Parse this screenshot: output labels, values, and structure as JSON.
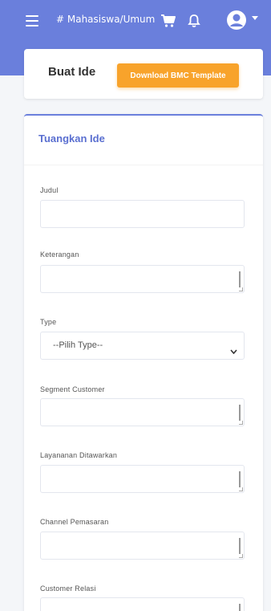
{
  "header": {
    "brand": "# Mahasiswa/Umum",
    "icons": [
      "hamburger-icon",
      "cart-icon",
      "bell-icon",
      "user-avatar-icon",
      "caret-down-icon"
    ]
  },
  "title_card": {
    "title": "Buat Ide",
    "download_button": "Download BMC Template"
  },
  "form": {
    "heading": "Tuangkan Ide",
    "fields": [
      {
        "label": "Judul",
        "type": "text",
        "value": ""
      },
      {
        "label": "Keterangan",
        "type": "textarea",
        "value": ""
      },
      {
        "label": "Type",
        "type": "select",
        "selected": "--Pilih Type--"
      },
      {
        "label": "Segment Customer",
        "type": "textarea",
        "value": ""
      },
      {
        "label": "Layananan Ditawarkan",
        "type": "textarea",
        "value": ""
      },
      {
        "label": "Channel Pemasaran",
        "type": "textarea",
        "value": ""
      },
      {
        "label": "Customer Relasi",
        "type": "textarea",
        "value": ""
      }
    ]
  },
  "colors": {
    "primary": "#6a7fdc",
    "accent": "#f8a32b",
    "background": "#f4f6f9"
  }
}
